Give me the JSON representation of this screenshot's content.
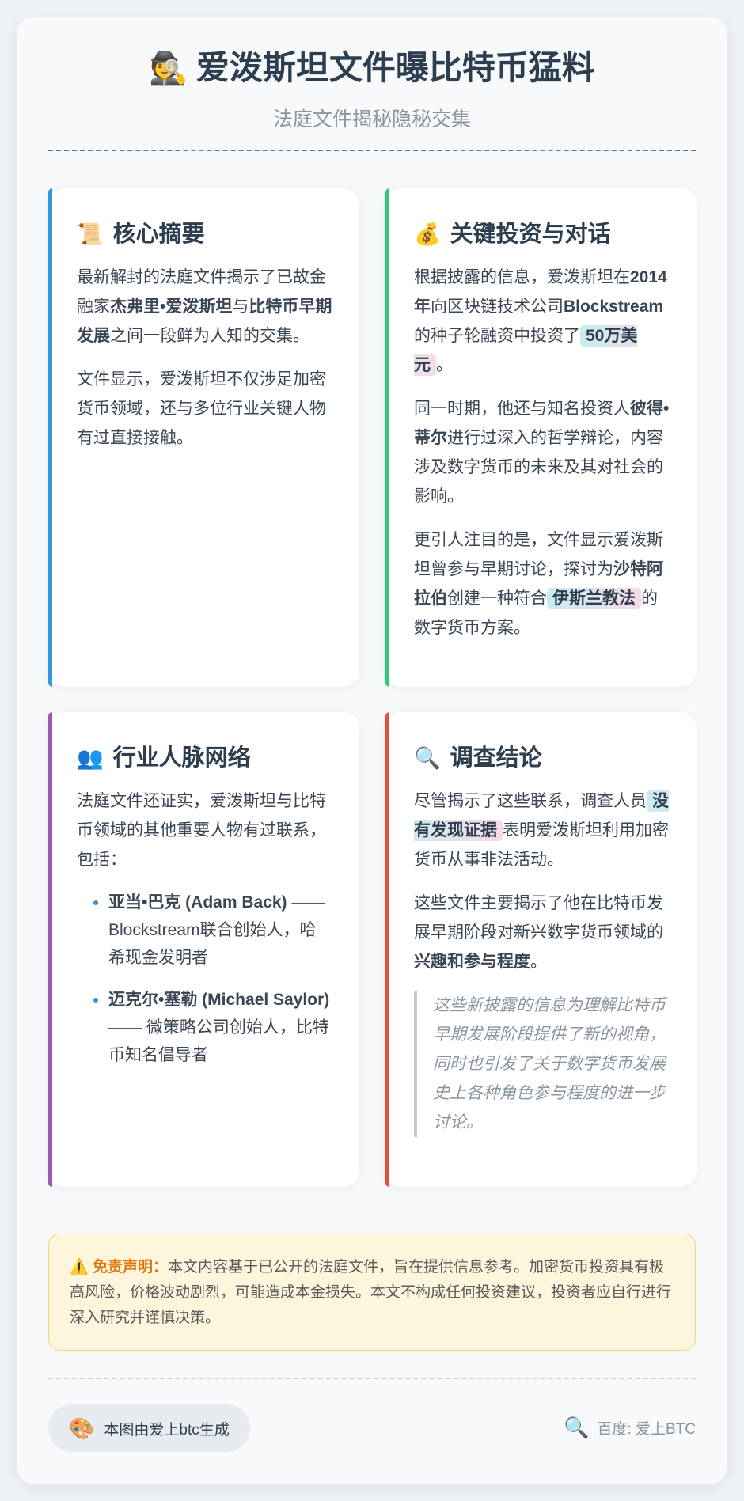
{
  "header": {
    "emoji": "🕵️",
    "title": "爱泼斯坦文件曝比特币猛料",
    "subtitle": "法庭文件揭秘隐秘交集"
  },
  "cards": {
    "summary": {
      "emoji": "📜",
      "title": "核心摘要",
      "p1": {
        "t1": "最新解封的法庭文件揭示了已故金融家",
        "b1": "杰弗里•爱泼斯坦",
        "t2": "与",
        "b2": "比特币早期发展",
        "t3": "之间一段鲜为人知的交集。"
      },
      "p2": "文件显示，爱泼斯坦不仅涉足加密货币领域，还与多位行业关键人物有过直接接触。"
    },
    "investment": {
      "emoji": "💰",
      "title": "关键投资与对话",
      "p1": {
        "t1": "根据披露的信息，爱泼斯坦在",
        "b1": "2014年",
        "t2": "向区块链技术公司",
        "b2": "Blockstream",
        "t3": "的种子轮融资中投资了",
        "hl": "50万美元",
        "t4": "。"
      },
      "p2": {
        "t1": "同一时期，他还与知名投资人",
        "b1": "彼得•蒂尔",
        "t2": "进行过深入的哲学辩论，内容涉及数字货币的未来及其对社会的影响。"
      },
      "p3": {
        "t1": "更引人注目的是，文件显示爱泼斯坦曾参与早期讨论，探讨为",
        "b1": "沙特阿拉伯",
        "t2": "创建一种符合",
        "hl": "伊斯兰教法",
        "t3": "的数字货币方案。"
      }
    },
    "network": {
      "emoji": "👥",
      "title": "行业人脉网络",
      "intro": "法庭文件还证实，爱泼斯坦与比特币领域的其他重要人物有过联系，包括：",
      "items": [
        {
          "name": "亚当•巴克 (Adam Back)",
          "desc": " —— Blockstream联合创始人，哈希现金发明者"
        },
        {
          "name": "迈克尔•塞勒 (Michael Saylor)",
          "desc": " —— 微策略公司创始人，比特币知名倡导者"
        }
      ]
    },
    "conclusion": {
      "emoji": "🔍",
      "title": "调查结论",
      "p1": {
        "t1": "尽管揭示了这些联系，调查人员",
        "hl": "没有发现证据",
        "t2": "表明爱泼斯坦利用加密货币从事非法活动。"
      },
      "p2": {
        "t1": "这些文件主要揭示了他在比特币发展早期阶段对新兴数字货币领域的",
        "b1": "兴趣和参与程度",
        "t2": "。"
      },
      "quote": "这些新披露的信息为理解比特币早期发展阶段提供了新的视角，同时也引发了关于数字货币发展史上各种角色参与程度的进一步讨论。"
    }
  },
  "disclaimer": {
    "emoji": "⚠️",
    "label": "免责声明：",
    "text": "本文内容基于已公开的法庭文件，旨在提供信息参考。加密货币投资具有极高风险，价格波动剧烈，可能造成本金损失。本文不构成任何投资建议，投资者应自行进行深入研究并谨慎决策。"
  },
  "footer": {
    "credit_emoji": "🎨",
    "credit": "本图由爱上btc生成",
    "source_emoji": "🔍",
    "source": "百度: 爱上BTC"
  },
  "colors": {
    "summary_accent": "#3498db",
    "investment_accent": "#2ecc71",
    "network_accent": "#9b59b6",
    "conclusion_accent": "#e74c3c"
  }
}
